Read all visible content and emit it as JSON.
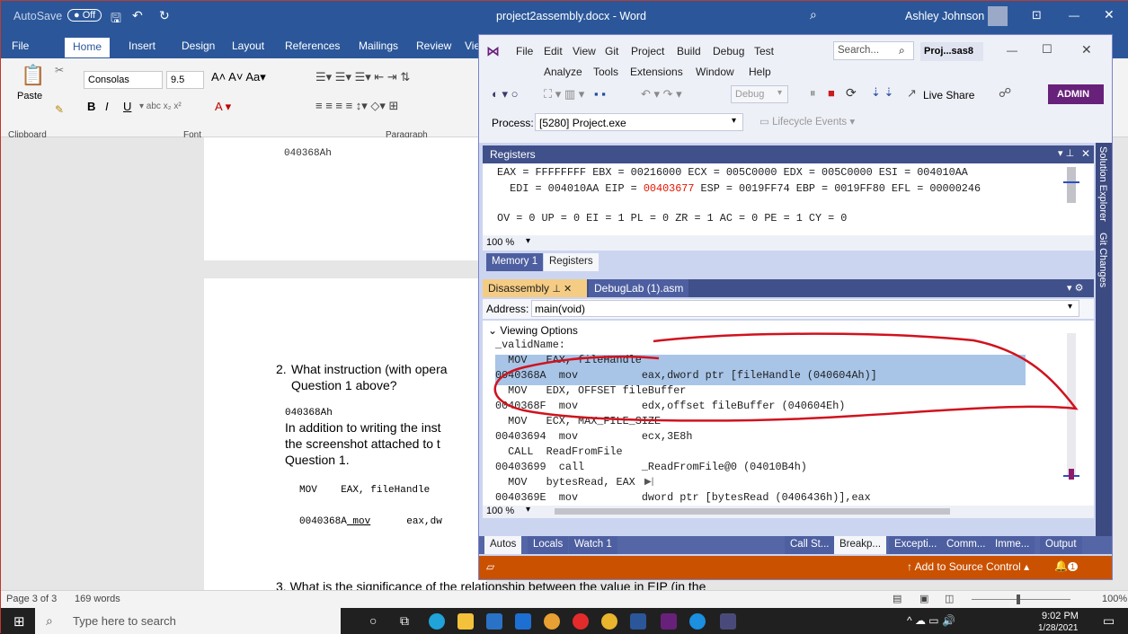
{
  "word": {
    "autosave": "AutoSave",
    "autosave_state": "Off",
    "title": "project2assembly.docx - Word",
    "user": "Ashley Johnson",
    "tabs": [
      "File",
      "Home",
      "Insert",
      "Design",
      "Layout",
      "References",
      "Mailings",
      "Review",
      "Vie"
    ],
    "font_name": "Consolas",
    "font_size": "9.5",
    "paste": "Paste",
    "groups": {
      "clipboard": "Clipboard",
      "font": "Font",
      "paragraph": "Paragraph"
    },
    "page_top_text": "040368Ah",
    "question2_num": "2.",
    "question2_a": "What instruction (with opera",
    "question2_b": "Question 1 above?",
    "answer_addr": "040368Ah",
    "para_a": "In addition to writing the inst",
    "para_b": "the screenshot attached to t",
    "para_c": "Question 1.",
    "code_line1": "MOV    EAX, fileHandle",
    "code_line2_addr": "0040368A",
    "code_line2_op": " mov",
    "code_line2_rest": "eax,dw",
    "question3": "3.  What is the significance of the relationship between the value in EIP (in the",
    "status_page": "Page 3 of 3",
    "status_words": "169 words",
    "zoom": "100%"
  },
  "taskbar": {
    "search_placeholder": "Type here to search",
    "time": "9:02 PM",
    "date": "1/28/2021"
  },
  "vs": {
    "menu_row1": [
      "File",
      "Edit",
      "View",
      "Git",
      "Project",
      "Build",
      "Debug",
      "Test"
    ],
    "search": "Search...",
    "project_badge": "Proj...sas8",
    "menu_row2": [
      "Analyze",
      "Tools",
      "Extensions",
      "Window",
      "Help"
    ],
    "config": "Debug",
    "live_share": "Live Share",
    "admin": "ADMIN",
    "process_label": "Process:",
    "process_value": "[5280] Project.exe",
    "lifecycle": "Lifecycle Events",
    "registers_title": "Registers",
    "reg_line1": "EAX = FFFFFFFF EBX = 00216000 ECX = 005C0000 EDX = 005C0000 ESI = 004010AA",
    "reg_line2_a": "  EDI = 004010AA EIP = ",
    "reg_eip": "00403677",
    "reg_line2_b": " ESP = 0019FF74 EBP = 0019FF80 EFL = 00000246",
    "reg_line3": "OV = 0 UP = 0 EI = 1 PL = 0 ZR = 1 AC = 0 PE = 1 CY = 0",
    "zoom1": "100 %",
    "tabs_mid": [
      "Memory 1",
      "Registers"
    ],
    "dis_tab": "Disassembly",
    "asm_tab": "DebugLab (1).asm",
    "address_label": "Address:",
    "address_value": "main(void)",
    "viewing_options": "Viewing Options",
    "lines": [
      "_validName:",
      "  MOV   EAX, fileHandle",
      "0040368A  mov          eax,dword ptr [fileHandle (040604Ah)]",
      "  MOV   EDX, OFFSET fileBuffer",
      "0040368F  mov          edx,offset fileBuffer (040604Eh)",
      "  MOV   ECX, MAX_FILE_SIZE",
      "00403694  mov          ecx,3E8h",
      "  CALL  ReadFromFile",
      "00403699  call         _ReadFromFile@0 (04010B4h)",
      "  MOV   bytesRead, EAX",
      "0040369E  mov          dword ptr [bytesRead (0406436h)],eax"
    ],
    "zoom2": "100 %",
    "bottom_left_tabs": [
      "Autos",
      "Locals",
      "Watch 1"
    ],
    "bottom_right_tabs": [
      "Call St...",
      "Breakp...",
      "Excepti...",
      "Comm...",
      "Imme...",
      "Output"
    ],
    "source_control": "Add to Source Control",
    "side_tabs": [
      "Solution Explorer",
      "Git Changes"
    ],
    "notif_count": "1"
  },
  "colors": {
    "word_blue": "#2b579a",
    "vs_purple": "#68217a",
    "eip_red": "#e51400",
    "annotation": "#d0121e",
    "vs_status": "#ca5100"
  }
}
